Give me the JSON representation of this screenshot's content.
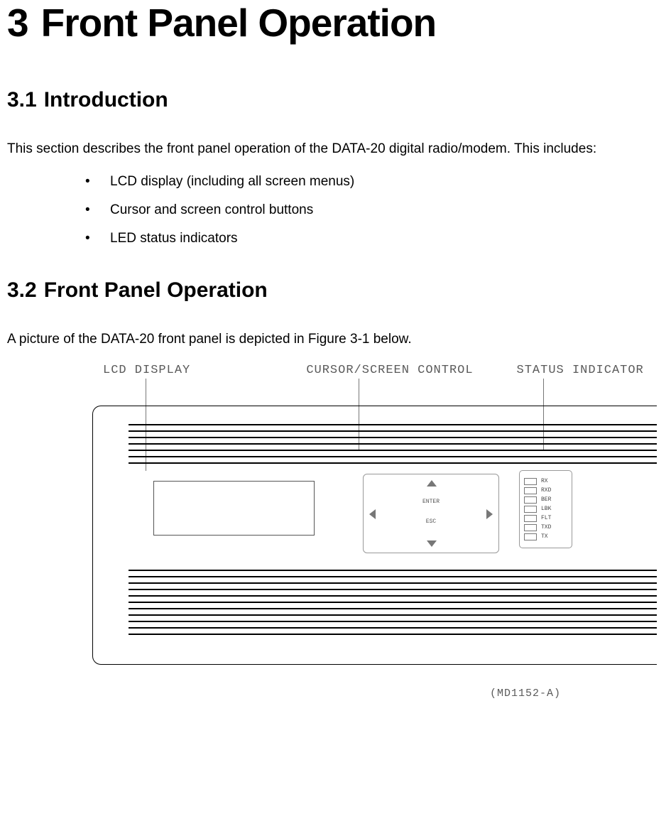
{
  "chapter": {
    "number": "3",
    "title": "Front Panel Operation"
  },
  "section1": {
    "number": "3.1",
    "title": "Introduction",
    "intro": "This section describes the front panel operation of the DATA-20 digital radio/modem.  This includes:",
    "bullets": [
      "LCD display (including all screen menus)",
      "Cursor and screen control buttons",
      "LED status indicators"
    ]
  },
  "section2": {
    "number": "3.2",
    "title": "Front Panel Operation",
    "intro": "A picture of the DATA-20 front panel is depicted in Figure 3-1 below."
  },
  "figure": {
    "label_lcd": "LCD DISPLAY",
    "label_cursor": "CURSOR/SCREEN CONTROL",
    "label_status": "STATUS INDICATOR",
    "enter": "ENTER",
    "esc": "ESC",
    "leds": [
      "RX",
      "RXD",
      "BER",
      "LBK",
      "FLT",
      "TXD",
      "TX"
    ],
    "drawing_id": "(MD1152-A)"
  }
}
